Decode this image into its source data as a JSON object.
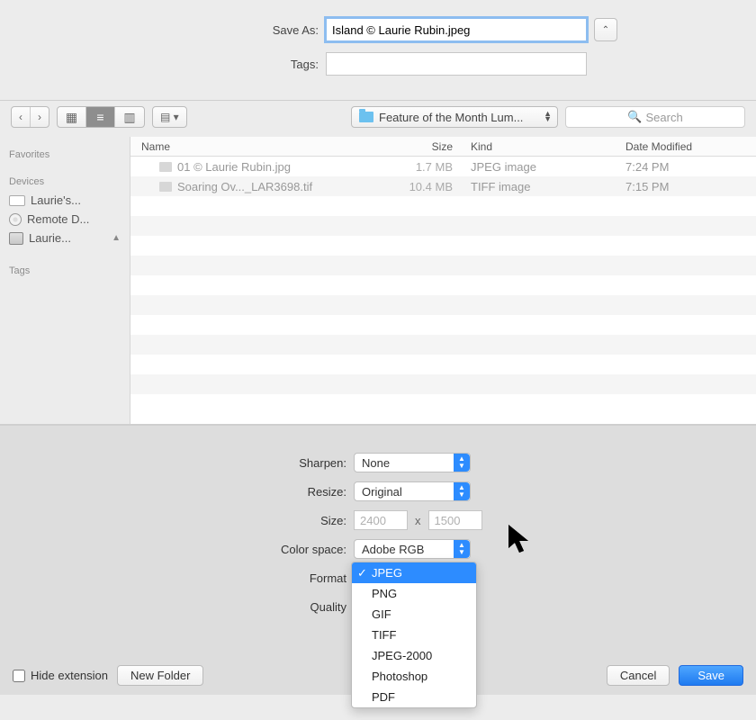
{
  "top": {
    "saveas_label": "Save As:",
    "filename": "Island © Laurie Rubin.jpeg",
    "tags_label": "Tags:",
    "tags_value": ""
  },
  "toolbar": {
    "back": "‹",
    "forward": "›",
    "folder_label": "Feature of the Month Lum...",
    "search_placeholder": "Search"
  },
  "sidebar": {
    "favorites_header": "Favorites",
    "devices_header": "Devices",
    "tags_header": "Tags",
    "devices": [
      {
        "label": "Laurie's..."
      },
      {
        "label": "Remote D..."
      },
      {
        "label": "Laurie..."
      }
    ]
  },
  "columns": {
    "name": "Name",
    "size": "Size",
    "kind": "Kind",
    "date": "Date Modified"
  },
  "files": [
    {
      "name": "01 © Laurie Rubin.jpg",
      "size": "1.7 MB",
      "kind": "JPEG image",
      "date": "7:24 PM"
    },
    {
      "name": "Soaring Ov..._LAR3698.tif",
      "size": "10.4 MB",
      "kind": "TIFF image",
      "date": "7:15 PM"
    }
  ],
  "options": {
    "sharpen_label": "Sharpen:",
    "sharpen_value": "None",
    "resize_label": "Resize:",
    "resize_value": "Original",
    "size_label": "Size:",
    "size_w": "2400",
    "size_h": "1500",
    "colorspace_label": "Color space:",
    "colorspace_value": "Adobe RGB",
    "format_label": "Format",
    "quality_label": "Quality"
  },
  "format_menu": [
    "JPEG",
    "PNG",
    "GIF",
    "TIFF",
    "JPEG-2000",
    "Photoshop",
    "PDF"
  ],
  "format_selected": "JPEG",
  "bottom": {
    "hide_ext": "Hide extension",
    "new_folder": "New Folder",
    "cancel": "Cancel",
    "save": "Save"
  }
}
